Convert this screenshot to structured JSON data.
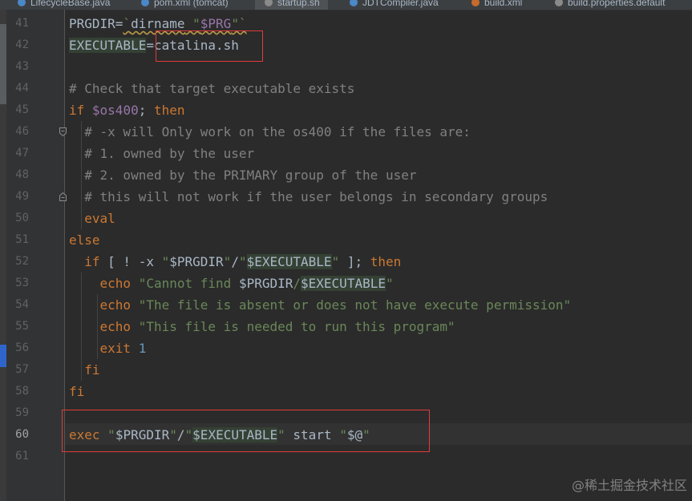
{
  "tabs": [
    {
      "label": "LifecycleBase.java",
      "icon": "java-class-icon",
      "color": "#4a88c7",
      "active": false
    },
    {
      "label": "pom.xml (tomcat)",
      "icon": "maven-icon",
      "color": "#4a88c7",
      "active": false
    },
    {
      "label": "startup.sh",
      "icon": "shell-file-icon",
      "color": "#8a8a8a",
      "active": true
    },
    {
      "label": "JDTCompiler.java",
      "icon": "java-class-icon",
      "color": "#4a88c7",
      "active": false
    },
    {
      "label": "build.xml",
      "icon": "ant-build-icon",
      "color": "#c66b2d",
      "active": false
    },
    {
      "label": "build.properties.default",
      "icon": "properties-file-icon",
      "color": "#8a8a8a",
      "active": false
    }
  ],
  "editor": {
    "current_line": 60,
    "lines": [
      {
        "n": "41",
        "t": [
          [
            "PRGDIR=",
            ""
          ],
          [
            "`",
            "str squig"
          ],
          [
            "dirname",
            "squig"
          ],
          [
            " \"",
            "str squig"
          ],
          [
            "$PRG",
            "var squig"
          ],
          [
            "\"`",
            "str squig"
          ]
        ]
      },
      {
        "n": "42",
        "t": [
          [
            "EXECUTABLE",
            "hl"
          ],
          [
            "=catalina.sh",
            ""
          ]
        ]
      },
      {
        "n": "43",
        "t": []
      },
      {
        "n": "44",
        "t": [
          [
            "# Check that target executable exists",
            "cmt"
          ]
        ]
      },
      {
        "n": "45",
        "t": [
          [
            "if ",
            "kw"
          ],
          [
            "$os400",
            "var"
          ],
          [
            "; ",
            ""
          ],
          [
            "then",
            "kw"
          ]
        ]
      },
      {
        "n": "46",
        "t": [
          [
            "  # -x will Only work on the os400 if the files are:",
            "cmt"
          ]
        ]
      },
      {
        "n": "47",
        "t": [
          [
            "  # 1. owned by the user",
            "cmt"
          ]
        ]
      },
      {
        "n": "48",
        "t": [
          [
            "  # 2. owned by the PRIMARY group of the user",
            "cmt"
          ]
        ]
      },
      {
        "n": "49",
        "t": [
          [
            "  # this will not work if the user belongs in secondary groups",
            "cmt"
          ]
        ]
      },
      {
        "n": "50",
        "t": [
          [
            "  eval",
            "kw"
          ]
        ]
      },
      {
        "n": "51",
        "t": [
          [
            "else",
            "kw"
          ]
        ]
      },
      {
        "n": "52",
        "t": [
          [
            "  if",
            "kw"
          ],
          [
            " [ ! -x ",
            ""
          ],
          [
            "\"",
            "str"
          ],
          [
            "$PRGDIR",
            ""
          ],
          [
            "\"",
            "str"
          ],
          [
            "/",
            ""
          ],
          [
            "\"",
            "str"
          ],
          [
            "$EXECUTABLE",
            "hl"
          ],
          [
            "\"",
            "str"
          ],
          [
            " ]; ",
            ""
          ],
          [
            "then",
            "kw"
          ]
        ]
      },
      {
        "n": "53",
        "t": [
          [
            "    echo ",
            "kw"
          ],
          [
            "\"Cannot find ",
            "str"
          ],
          [
            "$PRGDIR",
            ""
          ],
          [
            "/",
            "str"
          ],
          [
            "$EXECUTABLE",
            "hl"
          ],
          [
            "\"",
            "str"
          ]
        ]
      },
      {
        "n": "54",
        "t": [
          [
            "    echo ",
            "kw"
          ],
          [
            "\"The file is absent or does not have execute permission\"",
            "str"
          ]
        ]
      },
      {
        "n": "55",
        "t": [
          [
            "    echo ",
            "kw"
          ],
          [
            "\"This file is needed to run this program\"",
            "str"
          ]
        ]
      },
      {
        "n": "56",
        "t": [
          [
            "    exit ",
            "kw"
          ],
          [
            "1",
            "num"
          ]
        ]
      },
      {
        "n": "57",
        "t": [
          [
            "  fi",
            "kw"
          ]
        ]
      },
      {
        "n": "58",
        "t": [
          [
            "fi",
            "kw"
          ]
        ]
      },
      {
        "n": "59",
        "t": []
      },
      {
        "n": "60",
        "t": [
          [
            "exec ",
            "kw"
          ],
          [
            "\"",
            "str"
          ],
          [
            "$PRGDIR",
            ""
          ],
          [
            "\"",
            "str"
          ],
          [
            "/",
            ""
          ],
          [
            "\"",
            "str"
          ],
          [
            "$EXECUTABLE",
            "hl"
          ],
          [
            "\"",
            "str"
          ],
          [
            " start ",
            ""
          ],
          [
            "\"",
            "str"
          ],
          [
            "$@",
            ""
          ],
          [
            "\"",
            "str"
          ]
        ]
      },
      {
        "n": "61",
        "t": []
      }
    ]
  },
  "watermark": "@稀土掘金技术社区",
  "colors": {
    "keyword": "#cc7832",
    "string": "#6a8759",
    "comment": "#808080",
    "number": "#6897bb",
    "variable": "#9876aa",
    "annotation_box": "#e03b3b"
  }
}
